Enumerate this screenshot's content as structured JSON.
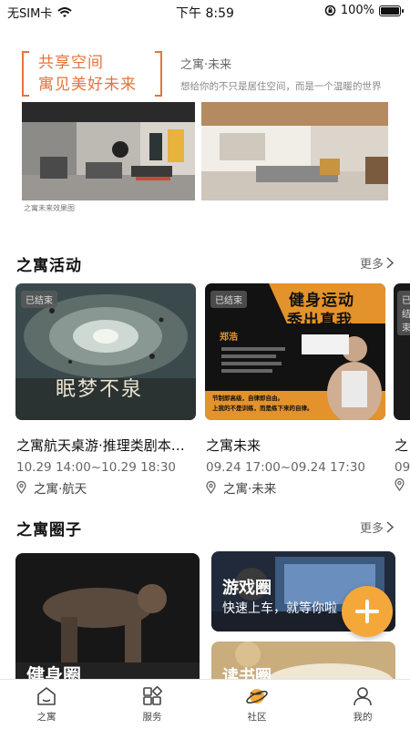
{
  "status_bar": {
    "carrier": "无SIM卡",
    "time": "下午 8:59",
    "battery": "100%",
    "battery_level": 1.0
  },
  "banner": {
    "slogan_line1": "共享空间",
    "slogan_line2": "寓见美好未来",
    "place": "之寓·未来",
    "tagline": "想给你的不只是居住空间，而是一个温暖的世界",
    "caption": "之寓未来效果图"
  },
  "activities": {
    "title": "之寓活动",
    "more": "更多",
    "items": [
      {
        "badge": "已结束",
        "poster_title": "眠梦不泉",
        "title": "之寓航天桌游·推理类剧本…",
        "time": "10.29 14:00~10.29 18:30",
        "location": "之寓·航天"
      },
      {
        "badge": "已结束",
        "poster_title_1": "健身运动",
        "poster_title_2": "秀出真我",
        "poster_name": "郑浩",
        "poster_slogan_1": "节制即高级，自律即自由。",
        "poster_slogan_2": "上我的不是训练，而是练下来的自律。",
        "title": "之寓未来",
        "time": "09.24 17:00~09.24 17:30",
        "location": "之寓·未来"
      },
      {
        "badge": "已结束",
        "title": "之",
        "time": "09",
        "location": ""
      }
    ]
  },
  "circles": {
    "title": "之寓圈子",
    "more": "更多",
    "items": [
      {
        "name": "健身圈"
      },
      {
        "name": "游戏圈",
        "desc": "快速上车，就等你啦"
      },
      {
        "name": "读书圈"
      }
    ]
  },
  "tab_bar": {
    "active_color": "#f5a83a",
    "tabs": [
      {
        "label": "之寓",
        "icon": "home-icon"
      },
      {
        "label": "服务",
        "icon": "services-icon"
      },
      {
        "label": "社区",
        "icon": "planet-icon"
      },
      {
        "label": "我的",
        "icon": "profile-icon"
      }
    ]
  }
}
